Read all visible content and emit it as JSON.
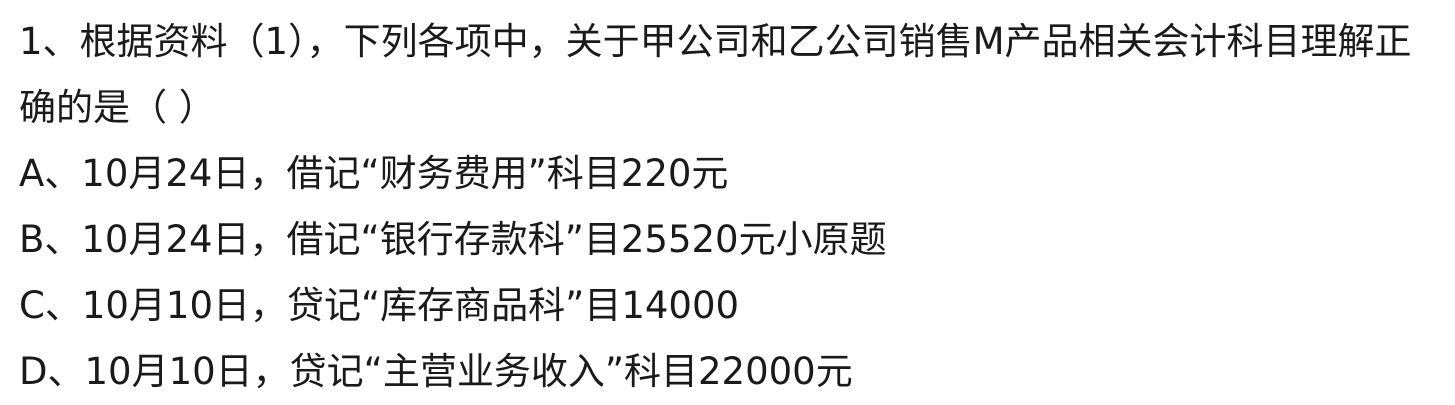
{
  "question": {
    "stem": "1、根据资料（1），下列各项中，关于甲公司和乙公司销售M产品相关会计科目理解正确的是（ ）",
    "options": [
      "A、10月24日，借记“财务费用”科目220元",
      "B、10月24日，借记“银行存款科”目25520元小原题",
      "C、10月10日，贷记“库存商品科”目14000",
      "D、10月10日，贷记“主营业务收入”科目22000元"
    ]
  }
}
